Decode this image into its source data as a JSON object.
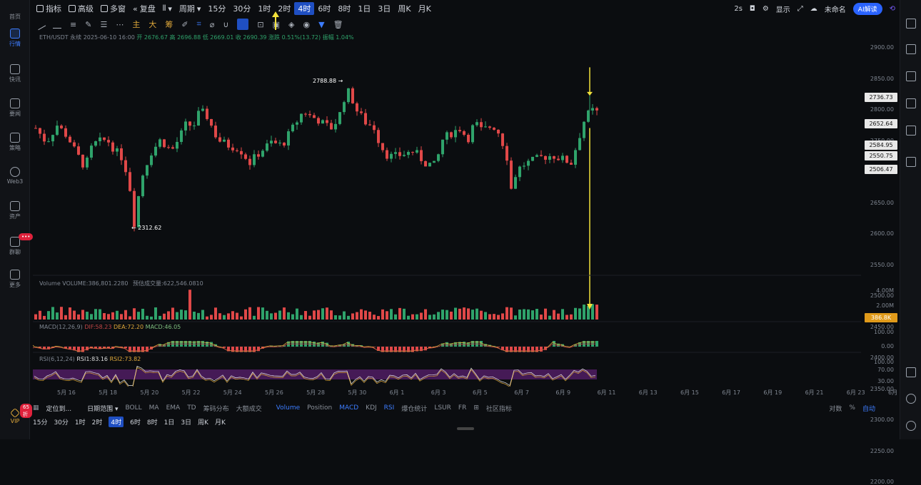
{
  "left_nav": [
    {
      "label": "首页",
      "icon": "home-icon"
    },
    {
      "label": "行情",
      "icon": "market-icon",
      "active": true
    },
    {
      "label": "快讯",
      "icon": "news-flash-icon"
    },
    {
      "label": "要闻",
      "icon": "headline-icon"
    },
    {
      "label": "策略",
      "icon": "strategy-icon"
    },
    {
      "label": "Web3",
      "icon": "web3-icon"
    },
    {
      "label": "资产",
      "icon": "asset-icon"
    },
    {
      "label": "群聊",
      "icon": "chat-icon",
      "badge": "•••"
    },
    {
      "label": "更多",
      "icon": "more-icon"
    }
  ],
  "vip": {
    "label": "VIP",
    "badge": "65折"
  },
  "toolbar": {
    "items": [
      {
        "label": "指标"
      },
      {
        "label": "高级"
      },
      {
        "label": "多窗"
      },
      {
        "label": "复盘"
      },
      {
        "label": "周期"
      },
      {
        "label": "15分"
      },
      {
        "label": "30分"
      },
      {
        "label": "1时"
      },
      {
        "label": "2时"
      },
      {
        "label": "4时",
        "active": true
      },
      {
        "label": "6时"
      },
      {
        "label": "8时"
      },
      {
        "label": "1日"
      },
      {
        "label": "3日"
      },
      {
        "label": "周K"
      },
      {
        "label": "月K"
      }
    ],
    "right": {
      "speed": "2s",
      "display": "显示",
      "name": "未命名",
      "ai": "AI解读"
    }
  },
  "draw_tools": [
    "主",
    "大",
    "筹"
  ],
  "legend": {
    "symbol": "ETH/USDT 永续 2025-06-10 16:00",
    "open": "开 2676.67",
    "high": "高 2696.88",
    "low": "低 2669.01",
    "close": "收 2690.39",
    "change": "涨跌 0.51%(13.72)",
    "amplitude": "振幅 1.04%"
  },
  "price_axis": [
    "2900.00",
    "2850.00",
    "2800.00",
    "2750.00",
    "2700.00",
    "2650.00",
    "2600.00",
    "2550.00",
    "2500.00",
    "2450.00",
    "2400.00",
    "2350.00",
    "2300.00",
    "2250.00",
    "2200.00"
  ],
  "price_tags": [
    "2736.73",
    "2652.64",
    "2584.95",
    "2550.75",
    "2506.47"
  ],
  "annotations": {
    "high": "2788.88 →",
    "low": "← 2312.62"
  },
  "volume": {
    "legend": "Volume  VOLUME:386,801.2280",
    "legend2": "预估成交量:622,546.0810",
    "axis": [
      "4.00M",
      "2.00M"
    ],
    "tag": "386.8K"
  },
  "macd": {
    "legend": "MACD(12,26,9)",
    "dif": "DIF:58.23",
    "dea": "DEA:72.20",
    "macd": "MACD:46.05",
    "axis": [
      "100.00",
      "0.00"
    ]
  },
  "rsi": {
    "legend": "RSI(6,12,24)",
    "rsi1": "RSI1:83.16",
    "rsi2": "RSI2:73.82",
    "axis": [
      "100.00",
      "70.00",
      "30.00"
    ]
  },
  "x_axis": [
    "5月 16",
    "5月 18",
    "5月 20",
    "5月 22",
    "5月 24",
    "5月 26",
    "5月 28",
    "5月 30",
    "6月 1",
    "6月 3",
    "6月 5",
    "6月 7",
    "6月 9",
    "6月 11",
    "6月 13",
    "6月 15",
    "6月 17",
    "6月 19",
    "6月 21",
    "6月 23",
    "6月"
  ],
  "bottom_bar": {
    "items": [
      "定位到...",
      "日期范围",
      "BOLL",
      "MA",
      "EMA",
      "TD",
      "筹码分布",
      "大额成交",
      "Volume",
      "Position",
      "MACD",
      "KDJ",
      "RSI",
      "爆仓统计",
      "LSUR",
      "FR",
      "社区指标"
    ],
    "right": [
      "对数",
      "%",
      "自动"
    ]
  },
  "period_bar": [
    {
      "label": "15分"
    },
    {
      "label": "30分"
    },
    {
      "label": "1时"
    },
    {
      "label": "2时"
    },
    {
      "label": "4时",
      "active": true
    },
    {
      "label": "6时"
    },
    {
      "label": "8时"
    },
    {
      "label": "1日"
    },
    {
      "label": "3日"
    },
    {
      "label": "周K"
    },
    {
      "label": "月K"
    }
  ],
  "colors": {
    "up": "#2fa36b",
    "down": "#e04848",
    "accent": "#1f4fc2",
    "arrow": "#f2e13a"
  }
}
